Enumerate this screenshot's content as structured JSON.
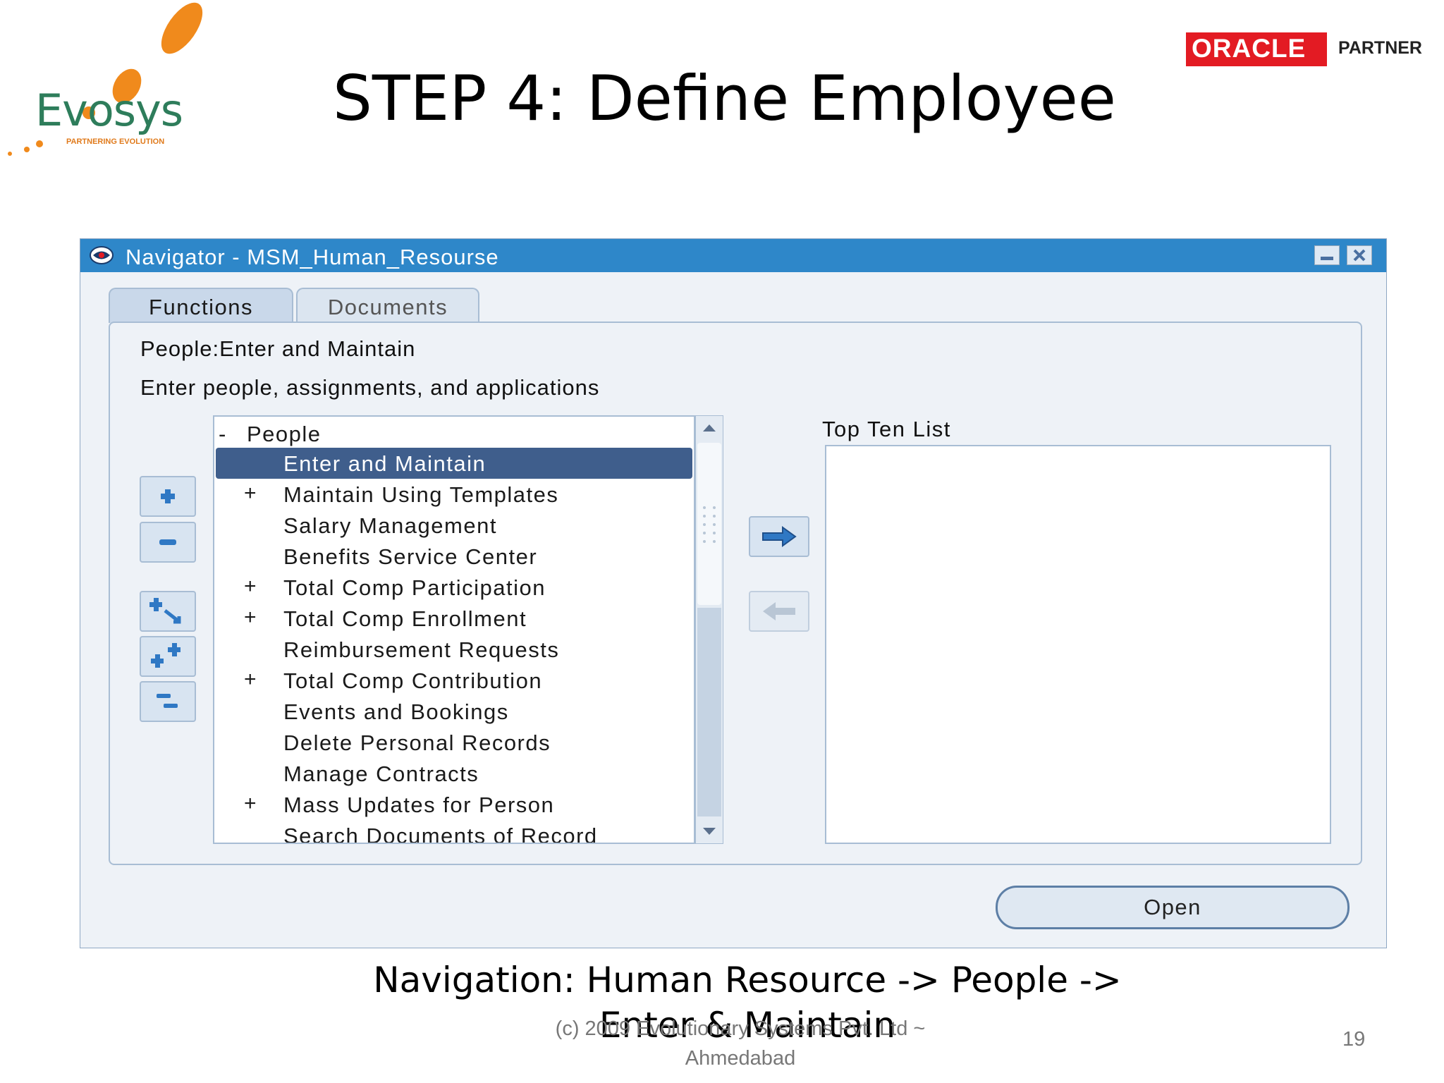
{
  "slide": {
    "title": "STEP 4: Define Employee",
    "navigation_caption": "Navigation: Human Resource -> People -> Enter & Maintain",
    "footer": "(c) 2009 Evolutionary Systems Pvt. Ltd ~ Ahmedabad",
    "page_number": "19",
    "logo": {
      "text": "Evosys",
      "tagline": "PARTNERING EVOLUTION",
      "accent_color": "#f08a1c",
      "text_color": "#2e7d5b"
    },
    "oracle": {
      "brand": "ORACLE",
      "label": "PARTNER",
      "color": "#e31b23"
    }
  },
  "window": {
    "title": "Navigator - MSM_Human_Resourse",
    "titlebar_color": "#2e87c9",
    "tabs": [
      {
        "label": "Functions",
        "active": true
      },
      {
        "label": "Documents",
        "active": false
      }
    ],
    "function_label": "People:Enter and Maintain",
    "function_description": "Enter people, assignments, and applications",
    "tree": {
      "root": {
        "symbol": "-",
        "label": "People"
      },
      "items": [
        {
          "symbol": "",
          "label": "Enter and Maintain",
          "selected": true
        },
        {
          "symbol": "+",
          "label": "Maintain Using Templates"
        },
        {
          "symbol": "",
          "label": "Salary Management"
        },
        {
          "symbol": "",
          "label": "Benefits Service Center"
        },
        {
          "symbol": "+",
          "label": "Total Comp Participation"
        },
        {
          "symbol": "+",
          "label": "Total Comp Enrollment"
        },
        {
          "symbol": "",
          "label": "Reimbursement Requests"
        },
        {
          "symbol": "+",
          "label": "Total Comp Contribution"
        },
        {
          "symbol": "",
          "label": "Events and Bookings"
        },
        {
          "symbol": "",
          "label": "Delete Personal Records"
        },
        {
          "symbol": "",
          "label": "Manage Contracts"
        },
        {
          "symbol": "+",
          "label": "Mass Updates for Person"
        },
        {
          "symbol": "",
          "label": "Search Documents of Record"
        }
      ],
      "selected_color": "#3f5e8c"
    },
    "top_ten_label": "Top Ten List",
    "open_button": "Open"
  }
}
